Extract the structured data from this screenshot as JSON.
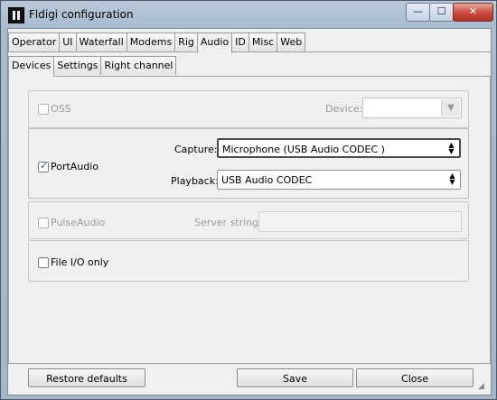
{
  "window": {
    "title": "Fldigi configuration",
    "controls": {
      "minimize": "—",
      "maximize": "☐",
      "close": "✕"
    }
  },
  "tabs": {
    "main": [
      "Operator",
      "UI",
      "Waterfall",
      "Modems",
      "Rig",
      "Audio",
      "ID",
      "Misc",
      "Web"
    ],
    "main_active": "Audio",
    "sub": [
      "Devices",
      "Settings",
      "Right channel"
    ],
    "sub_active": "Devices"
  },
  "oss": {
    "label": "OSS",
    "checked": false,
    "enabled": false,
    "device_label": "Device:",
    "device_value": ""
  },
  "portaudio": {
    "label": "PortAudio",
    "checked": true,
    "capture_label": "Capture:",
    "capture_value": "Microphone (USB Audio CODEC )",
    "playback_label": "Playback:",
    "playback_value": "USB Audio CODEC"
  },
  "pulseaudio": {
    "label": "PulseAudio",
    "checked": false,
    "enabled": false,
    "server_label": "Server string:",
    "server_value": ""
  },
  "fileio": {
    "label": "File I/O only",
    "checked": false
  },
  "buttons": {
    "restore": "Restore defaults",
    "save": "Save",
    "close": "Close"
  },
  "icons": {
    "app": "fldigi-app-icon",
    "combo_arrow": "updown-arrows-icon",
    "dropdown": "chevron-down-icon",
    "check": "checkmark-icon",
    "resize": "resize-grip-icon"
  },
  "colors": {
    "titlebar": "#a9bbcf",
    "client_bg": "#f0f0f0",
    "close_button": "#c8473a",
    "check_mark": "#1a55b5"
  }
}
